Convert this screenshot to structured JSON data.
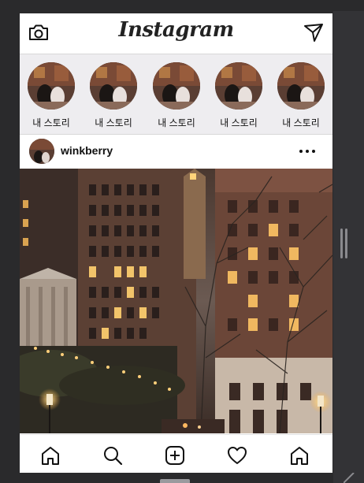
{
  "app": {
    "title": "Instagram"
  },
  "header": {
    "camera_icon": "camera-icon",
    "direct_icon": "paper-plane-icon"
  },
  "stories": [
    {
      "label": "내 스토리"
    },
    {
      "label": "내 스토리"
    },
    {
      "label": "내 스토리"
    },
    {
      "label": "내 스토리"
    },
    {
      "label": "내 스토리"
    }
  ],
  "post": {
    "username": "winkberry",
    "more_icon": "more-dots-icon",
    "image": "city-night-street-photo"
  },
  "bottom_nav": [
    {
      "icon": "home-icon"
    },
    {
      "icon": "search-icon"
    },
    {
      "icon": "add-post-icon"
    },
    {
      "icon": "heart-icon"
    },
    {
      "icon": "home-icon"
    }
  ]
}
